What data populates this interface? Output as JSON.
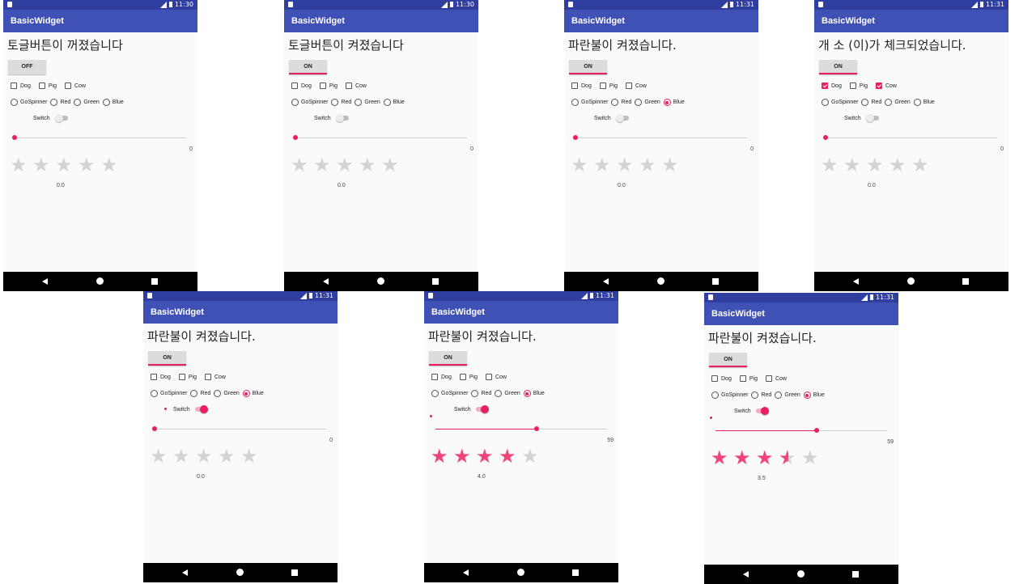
{
  "colors": {
    "status_bar": "#303f9f",
    "app_bar": "#3f51b5",
    "accent": "#e91e63",
    "star_on": "#f2447a",
    "star_off": "#d3d3d3",
    "nav_bar": "#000000"
  },
  "screens": [
    {
      "time": "11:30",
      "app_title": "BasicWidget",
      "message": "토글버튼이 꺼졌습니다",
      "toggle_label": "OFF",
      "toggle_on": false,
      "checkboxes": [
        {
          "label": "Dog",
          "checked": false
        },
        {
          "label": "Pig",
          "checked": false
        },
        {
          "label": "Cow",
          "checked": false
        }
      ],
      "radios": [
        {
          "label": "GoSpinner",
          "checked": false
        },
        {
          "label": "Red",
          "checked": false
        },
        {
          "label": "Green",
          "checked": false
        },
        {
          "label": "Blue",
          "checked": false
        }
      ],
      "switch_label": "Switch",
      "switch_on": false,
      "seek_value": "0",
      "seek_fraction": 0,
      "rating": 0,
      "rating_text": "0.0"
    },
    {
      "time": "11:30",
      "app_title": "BasicWidget",
      "message": "토글버튼이 켜졌습니다",
      "toggle_label": "ON",
      "toggle_on": true,
      "checkboxes": [
        {
          "label": "Dog",
          "checked": false
        },
        {
          "label": "Pig",
          "checked": false
        },
        {
          "label": "Cow",
          "checked": false
        }
      ],
      "radios": [
        {
          "label": "GoSpinner",
          "checked": false
        },
        {
          "label": "Red",
          "checked": false
        },
        {
          "label": "Green",
          "checked": false
        },
        {
          "label": "Blue",
          "checked": false
        }
      ],
      "switch_label": "Switch",
      "switch_on": false,
      "seek_value": "0",
      "seek_fraction": 0,
      "rating": 0,
      "rating_text": "0.0"
    },
    {
      "time": "11:31",
      "app_title": "BasicWidget",
      "message": "파란불이 켜졌습니다.",
      "toggle_label": "ON",
      "toggle_on": true,
      "checkboxes": [
        {
          "label": "Dog",
          "checked": false
        },
        {
          "label": "Pig",
          "checked": false
        },
        {
          "label": "Cow",
          "checked": false
        }
      ],
      "radios": [
        {
          "label": "GoSpinner",
          "checked": false
        },
        {
          "label": "Red",
          "checked": false
        },
        {
          "label": "Green",
          "checked": false
        },
        {
          "label": "Blue",
          "checked": true
        }
      ],
      "switch_label": "Switch",
      "switch_on": false,
      "seek_value": "0",
      "seek_fraction": 0,
      "rating": 0,
      "rating_text": "0.0"
    },
    {
      "time": "11:31",
      "app_title": "BasicWidget",
      "message": "개 소 (이)가 체크되었습니다.",
      "toggle_label": "ON",
      "toggle_on": true,
      "checkboxes": [
        {
          "label": "Dog",
          "checked": true
        },
        {
          "label": "Pig",
          "checked": false
        },
        {
          "label": "Cow",
          "checked": true
        }
      ],
      "radios": [
        {
          "label": "GoSpinner",
          "checked": false
        },
        {
          "label": "Red",
          "checked": false
        },
        {
          "label": "Green",
          "checked": false
        },
        {
          "label": "Blue",
          "checked": false
        }
      ],
      "switch_label": "Switch",
      "switch_on": false,
      "seek_value": "0",
      "seek_fraction": 0,
      "rating": 0,
      "rating_text": "0.0"
    },
    {
      "time": "11:31",
      "app_title": "BasicWidget",
      "message": "파란불이 켜졌습니다.",
      "toggle_label": "ON",
      "toggle_on": true,
      "checkboxes": [
        {
          "label": "Dog",
          "checked": false
        },
        {
          "label": "Pig",
          "checked": false
        },
        {
          "label": "Cow",
          "checked": false
        }
      ],
      "radios": [
        {
          "label": "GoSpinner",
          "checked": false
        },
        {
          "label": "Red",
          "checked": false
        },
        {
          "label": "Green",
          "checked": false
        },
        {
          "label": "Blue",
          "checked": true
        }
      ],
      "switch_label": "Switch",
      "switch_on": true,
      "seek_value": "0",
      "seek_fraction": 0,
      "rating": 0,
      "rating_text": "0.0"
    },
    {
      "time": "11:31",
      "app_title": "BasicWidget",
      "message": "파란불이 켜졌습니다.",
      "toggle_label": "ON",
      "toggle_on": true,
      "checkboxes": [
        {
          "label": "Dog",
          "checked": false
        },
        {
          "label": "Pig",
          "checked": false
        },
        {
          "label": "Cow",
          "checked": false
        }
      ],
      "radios": [
        {
          "label": "GoSpinner",
          "checked": false
        },
        {
          "label": "Red",
          "checked": false
        },
        {
          "label": "Green",
          "checked": false
        },
        {
          "label": "Blue",
          "checked": true
        }
      ],
      "switch_label": "Switch",
      "switch_on": true,
      "seek_value": "59",
      "seek_fraction": 0.59,
      "rating": 4,
      "rating_text": "4.0"
    },
    {
      "time": "11:31",
      "app_title": "BasicWidget",
      "message": "파란불이 켜졌습니다.",
      "toggle_label": "ON",
      "toggle_on": true,
      "checkboxes": [
        {
          "label": "Dog",
          "checked": false
        },
        {
          "label": "Pig",
          "checked": false
        },
        {
          "label": "Cow",
          "checked": false
        }
      ],
      "radios": [
        {
          "label": "GoSpinner",
          "checked": false
        },
        {
          "label": "Red",
          "checked": false
        },
        {
          "label": "Green",
          "checked": false
        },
        {
          "label": "Blue",
          "checked": true
        }
      ],
      "switch_label": "Switch",
      "switch_on": true,
      "seek_value": "59",
      "seek_fraction": 0.59,
      "rating": 3.5,
      "rating_text": "3.5"
    }
  ]
}
